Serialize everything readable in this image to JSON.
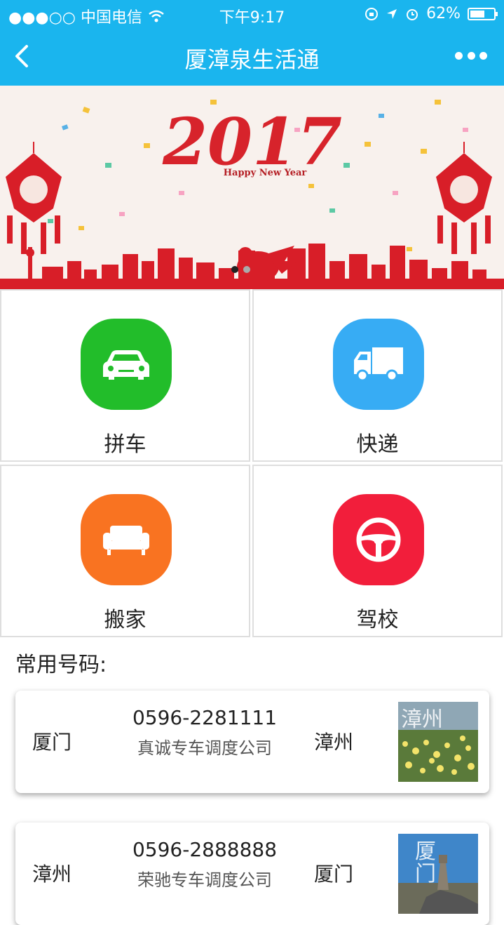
{
  "status_bar": {
    "carrier": "●●●○○ 中国电信",
    "time": "下午9:17",
    "battery": "62%",
    "battery_level": 0.62
  },
  "nav": {
    "title": "厦漳泉生活通",
    "back_icon": "chevron-left-icon",
    "more_icon": "more-dots-icon"
  },
  "banner": {
    "year": "2017",
    "tagline": "Happy New Year"
  },
  "services": [
    {
      "label": "拼车",
      "icon": "car-icon",
      "color": "#22bd2a"
    },
    {
      "label": "快递",
      "icon": "truck-icon",
      "color": "#37acf4"
    },
    {
      "label": "搬家",
      "icon": "sofa-icon",
      "color": "#f97321"
    },
    {
      "label": "驾校",
      "icon": "steering-wheel-icon",
      "color": "#f21e3b"
    }
  ],
  "section_title": "常用号码:",
  "contacts": [
    {
      "from": "厦门",
      "phone": "0596-2281111",
      "company": "真诚专车调度公司",
      "to": "漳州",
      "thumb_label": "漳州"
    },
    {
      "from": "漳州",
      "phone": "0596-2888888",
      "company": "荣驰专车调度公司",
      "to": "厦门",
      "thumb_label": "厦门"
    }
  ]
}
